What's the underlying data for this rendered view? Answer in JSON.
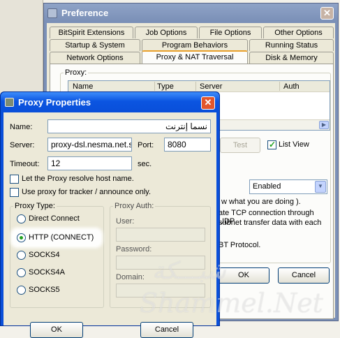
{
  "preference": {
    "title": "Preference",
    "tabs_row1": [
      "BitSpirit Extensions",
      "Job Options",
      "File Options",
      "Other Options"
    ],
    "tabs_row2": [
      "Startup & System",
      "Program Behaviors",
      "Running Status"
    ],
    "tabs_row3": [
      "Network Options",
      "Proxy & NAT Traversal",
      "Disk & Memory"
    ],
    "active_tab": "Proxy & NAT Traversal",
    "proxy_group": "Proxy:",
    "columns": [
      "Name",
      "Type",
      "Server",
      "Auth"
    ],
    "test_button": "Test",
    "list_view_label": "List View",
    "list_view_checked": true,
    "mode_select": "Enabled",
    "hint_text": "w what you are doing ).",
    "warning_line1": "ate TCP connection through UDP",
    "warning_line2": "subnet transfer data with each",
    "protocol_text": "BT Protocol.",
    "ok_label": "OK",
    "cancel_label": "Cancel"
  },
  "dialog": {
    "title": "Proxy Properties",
    "name_label": "Name:",
    "name_value": "نسما إنترنت",
    "server_label": "Server:",
    "server_value": "proxy-dsl.nesma.net.sa",
    "port_label": "Port:",
    "port_value": "8080",
    "timeout_label": "Timeout:",
    "timeout_value": "12",
    "timeout_unit": "sec.",
    "resolve_label": "Let the Proxy resolve host name.",
    "resolve_checked": false,
    "tracker_label": "Use proxy for tracker / announce only.",
    "tracker_checked": false,
    "proxy_type_label": "Proxy Type:",
    "proxy_types": [
      "Direct Connect",
      "HTTP (CONNECT)",
      "SOCKS4",
      "SOCKS4A",
      "SOCKS5"
    ],
    "selected_type": "HTTP (CONNECT)",
    "auth_label": "Proxy Auth:",
    "user_label": "User:",
    "password_label": "Password:",
    "domain_label": "Domain:",
    "ok_label": "OK",
    "cancel_label": "Cancel"
  },
  "watermark": {
    "arabic": "شبـــكة",
    "latin": "Shammel.Net"
  },
  "colors": {
    "dialog_title": "#0a4fd9",
    "preference_title": "#7b90b7",
    "active_tab_accent": "#e8a02a",
    "checkmark": "#21a121",
    "warning_text": "#c00000"
  }
}
